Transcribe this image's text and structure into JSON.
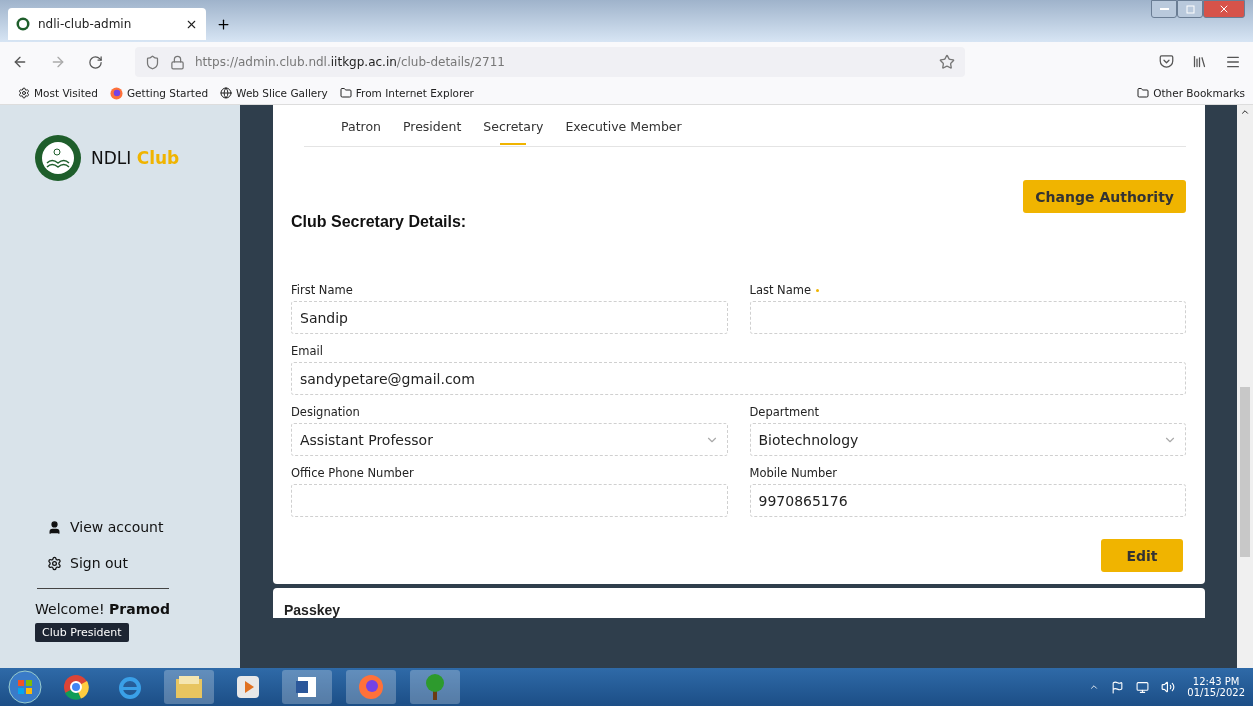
{
  "browser": {
    "tab_title": "ndli-club-admin",
    "url": "https://admin.club.ndl.**iitkgp.ac.in**/club-details/2711",
    "bookmarks": [
      {
        "kind": "gear",
        "label": "Most Visited"
      },
      {
        "kind": "firefox",
        "label": "Getting Started"
      },
      {
        "kind": "globe",
        "label": "Web Slice Gallery"
      },
      {
        "kind": "folder",
        "label": "From Internet Explorer"
      }
    ],
    "other_bookmarks": "Other Bookmarks"
  },
  "sidebar": {
    "brand": "NDLI",
    "brand_accent": "Club",
    "menu": [
      {
        "kind": "user",
        "label": "View account"
      },
      {
        "kind": "gear",
        "label": "Sign out"
      }
    ],
    "welcome": "Welcome! **Pramod**",
    "role": "Club President"
  },
  "tabs": [
    {
      "label": "Patron",
      "selected": false
    },
    {
      "label": "President",
      "selected": false
    },
    {
      "label": "Secretary",
      "selected": true
    },
    {
      "label": "Executive Member",
      "selected": false
    }
  ],
  "section_title": "Club Secretary Details:",
  "change_button": "Change Authority",
  "fields": [
    {
      "label": "First Name",
      "kind": "text",
      "value": "Sandip",
      "required": false,
      "wide": false
    },
    {
      "label": "Last Name",
      "kind": "text",
      "required": true,
      "wide": false
    },
    {
      "label": "Email",
      "kind": "text",
      "value": "sandypetare@gmail.com",
      "required": false,
      "wide": true
    },
    {
      "label": "Designation",
      "kind": "select",
      "value": "Assistant Professor",
      "required": false,
      "wide": false
    },
    {
      "label": "Department",
      "kind": "select",
      "value": "Biotechnology",
      "required": false,
      "wide": false
    },
    {
      "label": "Office Phone Number",
      "kind": "text",
      "required": false,
      "wide": false
    },
    {
      "label": "Mobile Number",
      "kind": "text",
      "value": "9970865176",
      "required": false,
      "wide": false
    }
  ],
  "edit_button": "Edit",
  "next_card_title": "Passkey",
  "taskbar": {
    "time": "12:43 PM",
    "date": "01/15/2022"
  }
}
